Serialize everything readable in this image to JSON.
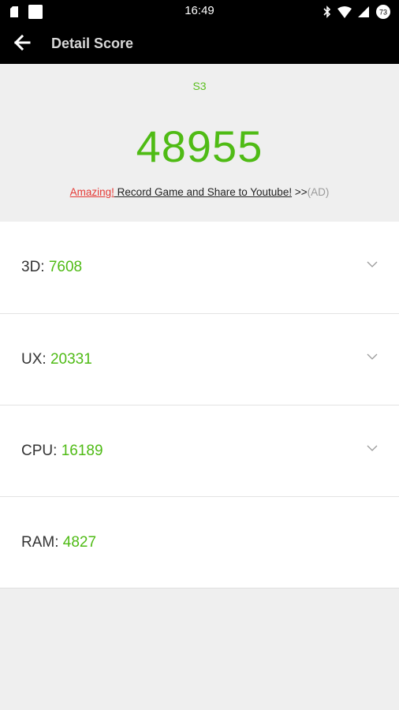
{
  "status_bar": {
    "time": "16:49",
    "left_icons": [
      "notification-icon",
      "square-notification-icon"
    ],
    "right_icons": [
      "bluetooth-icon",
      "wifi-icon",
      "cell-signal-icon",
      "battery-icon"
    ],
    "battery_level": "73"
  },
  "app_bar": {
    "title": "Detail Score",
    "back_icon": "arrow-left-icon"
  },
  "summary": {
    "device": "S3",
    "total_score": "48955",
    "promo": {
      "amazing": "Amazing!",
      "link_text": " Record Game and Share to Youtube!",
      "arrows": " >>",
      "ad": "(AD)"
    }
  },
  "scores": [
    {
      "label": "3D: ",
      "value": "7608",
      "expandable": true
    },
    {
      "label": "UX: ",
      "value": "20331",
      "expandable": true
    },
    {
      "label": "CPU: ",
      "value": "16189",
      "expandable": true
    },
    {
      "label": "RAM: ",
      "value": "4827",
      "expandable": false
    }
  ],
  "colors": {
    "accent_green": "#4fbb15",
    "promo_red": "#e53935",
    "background": "#efefef",
    "bar": "#000000"
  }
}
